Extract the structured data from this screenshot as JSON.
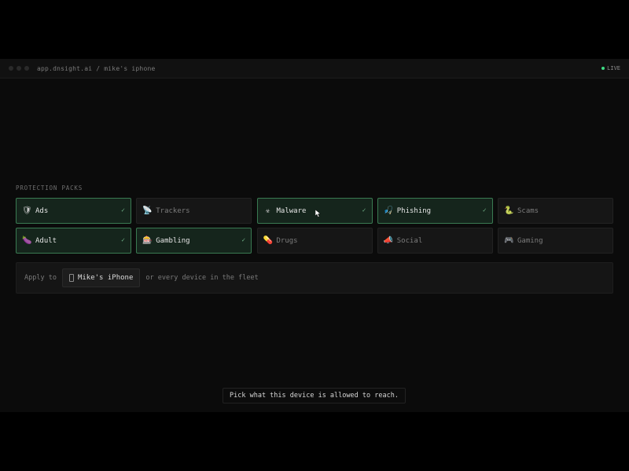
{
  "window": {
    "url": "app.dnsight.ai / mike's iphone",
    "status": "LIVE",
    "status_color": "#3ddc84"
  },
  "section_title": "PROTECTION PACKS",
  "packs": [
    {
      "label": "Ads",
      "icon": "shield-icon",
      "glyph": "🛡",
      "active": true
    },
    {
      "label": "Trackers",
      "icon": "satellite-dish-icon",
      "glyph": "📡",
      "active": false
    },
    {
      "label": "Malware",
      "icon": "biohazard-icon",
      "glyph": "☣",
      "active": true
    },
    {
      "label": "Phishing",
      "icon": "fishing-hook-icon",
      "glyph": "🎣",
      "active": true
    },
    {
      "label": "Scams",
      "icon": "scam-icon",
      "glyph": "🐍",
      "active": false
    },
    {
      "label": "Adult",
      "icon": "eggplant-icon",
      "glyph": "🍆",
      "active": true
    },
    {
      "label": "Gambling",
      "icon": "slot-machine-icon",
      "glyph": "🎰",
      "active": true
    },
    {
      "label": "Drugs",
      "icon": "pill-icon",
      "glyph": "💊",
      "active": false
    },
    {
      "label": "Social",
      "icon": "megaphone-icon",
      "glyph": "📣",
      "active": false
    },
    {
      "label": "Gaming",
      "icon": "gamepad-icon",
      "glyph": "🎮",
      "active": false
    }
  ],
  "apply": {
    "prefix": "Apply to",
    "device": "Mike's iPhone",
    "suffix": "or every device in the fleet"
  },
  "tooltip": "Pick what this device is allowed to reach.",
  "colors": {
    "active_border": "#3a7a52",
    "active_bg": "#15251c",
    "check": "#6fae85"
  }
}
